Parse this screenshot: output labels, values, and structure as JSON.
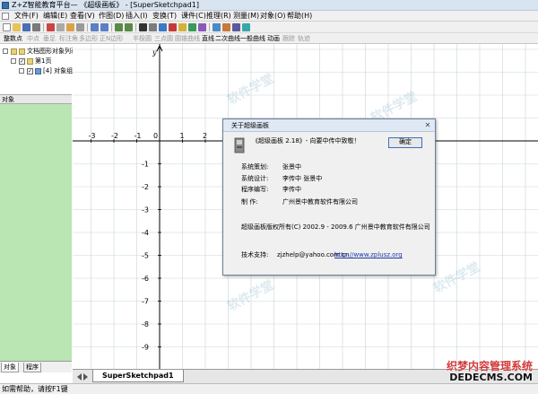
{
  "window": {
    "title": "Z+Z智能教育平台— 《超级画板》 - [SuperSketchpad1]"
  },
  "menu": [
    "文件(F)",
    "编辑(E)",
    "查看(V)",
    "作图(D)",
    "插入(I)",
    "变换(T)",
    "课件(C)",
    "推理(R)",
    "测量(M)",
    "对象(O)",
    "帮助(H)"
  ],
  "toolbar2": {
    "items": [
      {
        "label": "整数点",
        "enabled": true
      },
      {
        "label": "中点",
        "enabled": false
      },
      {
        "label": "垂足",
        "enabled": false
      },
      {
        "label": "标注角",
        "enabled": false
      },
      {
        "label": "多边形",
        "enabled": false
      },
      {
        "label": "正N边形",
        "enabled": false
      },
      {
        "label": "半极圆",
        "enabled": false
      },
      {
        "label": "三点圆",
        "enabled": false
      },
      {
        "label": "圆锥曲线",
        "enabled": false
      },
      {
        "label": "直线",
        "enabled": true
      },
      {
        "label": "二次曲线",
        "enabled": true
      },
      {
        "label": "一般曲线",
        "enabled": true
      },
      {
        "label": "动画",
        "enabled": true
      },
      {
        "label": "跟踪",
        "enabled": false
      },
      {
        "label": "轨迹",
        "enabled": false
      }
    ]
  },
  "left_panel": {
    "tree": [
      {
        "label": "文档图形对象列表"
      },
      {
        "label": "第1页"
      },
      {
        "label": "[4] 对象组"
      }
    ],
    "object_header": "对象",
    "tabs": [
      "对象",
      "程序"
    ]
  },
  "canvas": {
    "x_ticks": [
      "-4",
      "-3",
      "-2",
      "-1",
      "0",
      "1",
      "2",
      "3",
      "4",
      "5"
    ],
    "y_ticks": [
      "1",
      "2",
      "3",
      "4",
      "5",
      "6",
      "7",
      "8",
      "9",
      "10",
      "11",
      "12"
    ],
    "y_axis_label": "y",
    "x_axis_label": "x",
    "watermark_text": "软件学堂"
  },
  "dialog": {
    "title": "关于超级画板",
    "heading": "《超级画板 2.18》- 向要中传中致敬！",
    "ok_label": "确定",
    "rows": [
      {
        "label": "系统策划:",
        "value": "张景中"
      },
      {
        "label": "系统设计:",
        "value": "李传中 张景中"
      },
      {
        "label": "程序编写:",
        "value": "李传中"
      },
      {
        "label": "制    作:",
        "value": "广州景中教育软件有限公司"
      }
    ],
    "copyright": "超级画板版权所有(C) 2002.9 - 2009.6 广州景中教育软件有限公司",
    "support_label": "技术支持:",
    "support_email": "zjzhelp@yahoo.com.cn",
    "support_url": "http://www.zplusz.org"
  },
  "doc_tab": "SuperSketchpad1",
  "status": "如需帮助，请按F1键",
  "watermark": {
    "brand": "织梦内容管理系统",
    "url": "DEDECMS.COM"
  },
  "colors": {
    "titlebar": "#d9e4f1",
    "panel_green": "#b9e6b2",
    "grid": "#c9d6d9",
    "link": "#1a3aa8",
    "brand_red": "#d23b3b"
  }
}
